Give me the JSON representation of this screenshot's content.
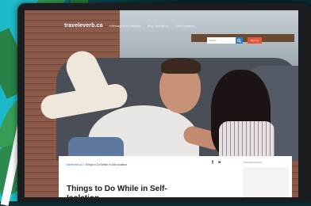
{
  "site": {
    "logo": "traveleverb.ca",
    "nav_links": [
      "A Message to our Members",
      "Blog: Destinations",
      "Travel Insurance"
    ]
  },
  "search": {
    "placeholder": "Search",
    "button_label": "Q",
    "signup_label": "Sign up"
  },
  "article": {
    "breadcrumb_home": "travelverb.ca",
    "breadcrumb_sep": " > ",
    "breadcrumb_current": "Things to Do While in Self-Isolation",
    "title": "Things to Do While in Self-Isolation",
    "share_facebook": "f",
    "share_twitter": "❝",
    "ad_label": "Advertisement"
  }
}
